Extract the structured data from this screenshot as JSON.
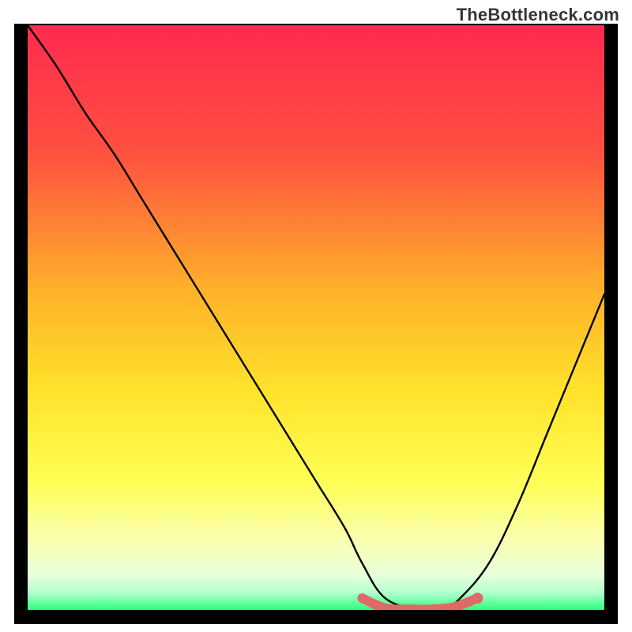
{
  "watermark": "TheBottleneck.com",
  "chart_data": {
    "type": "line",
    "title": "",
    "xlabel": "",
    "ylabel": "",
    "xlim": [
      0,
      100
    ],
    "ylim": [
      0,
      100
    ],
    "gradient_stops": [
      {
        "offset": 0,
        "color": "#ff2a4f"
      },
      {
        "offset": 22,
        "color": "#ff5140"
      },
      {
        "offset": 45,
        "color": "#ffb02a"
      },
      {
        "offset": 62,
        "color": "#ffe12a"
      },
      {
        "offset": 78,
        "color": "#ffff55"
      },
      {
        "offset": 88,
        "color": "#faffb0"
      },
      {
        "offset": 94,
        "color": "#e8ffda"
      },
      {
        "offset": 97,
        "color": "#b4ffd0"
      },
      {
        "offset": 100,
        "color": "#2cff7d"
      }
    ],
    "series": [
      {
        "name": "bottleneck-curve",
        "color": "#000000",
        "x": [
          0,
          5,
          10,
          15,
          20,
          25,
          30,
          35,
          40,
          45,
          50,
          55,
          58,
          62,
          68,
          72,
          75,
          80,
          85,
          90,
          95,
          100
        ],
        "y": [
          100,
          93,
          85,
          78,
          70,
          62,
          54,
          46,
          38,
          30,
          22,
          14,
          8,
          2,
          0,
          0,
          2,
          8,
          18,
          30,
          42,
          54
        ]
      }
    ],
    "highlight": {
      "name": "optimal-zone",
      "color": "#e06868",
      "x": [
        58,
        62,
        66,
        70,
        74,
        78
      ],
      "y": [
        2,
        0.3,
        0.1,
        0.1,
        0.5,
        2
      ]
    }
  }
}
